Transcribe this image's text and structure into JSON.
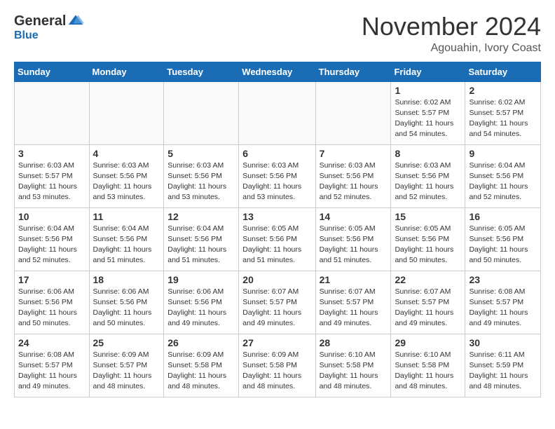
{
  "header": {
    "logo_general": "General",
    "logo_blue": "Blue",
    "month_title": "November 2024",
    "location": "Agouahin, Ivory Coast"
  },
  "weekdays": [
    "Sunday",
    "Monday",
    "Tuesday",
    "Wednesday",
    "Thursday",
    "Friday",
    "Saturday"
  ],
  "weeks": [
    [
      {
        "day": "",
        "info": ""
      },
      {
        "day": "",
        "info": ""
      },
      {
        "day": "",
        "info": ""
      },
      {
        "day": "",
        "info": ""
      },
      {
        "day": "",
        "info": ""
      },
      {
        "day": "1",
        "info": "Sunrise: 6:02 AM\nSunset: 5:57 PM\nDaylight: 11 hours\nand 54 minutes."
      },
      {
        "day": "2",
        "info": "Sunrise: 6:02 AM\nSunset: 5:57 PM\nDaylight: 11 hours\nand 54 minutes."
      }
    ],
    [
      {
        "day": "3",
        "info": "Sunrise: 6:03 AM\nSunset: 5:57 PM\nDaylight: 11 hours\nand 53 minutes."
      },
      {
        "day": "4",
        "info": "Sunrise: 6:03 AM\nSunset: 5:56 PM\nDaylight: 11 hours\nand 53 minutes."
      },
      {
        "day": "5",
        "info": "Sunrise: 6:03 AM\nSunset: 5:56 PM\nDaylight: 11 hours\nand 53 minutes."
      },
      {
        "day": "6",
        "info": "Sunrise: 6:03 AM\nSunset: 5:56 PM\nDaylight: 11 hours\nand 53 minutes."
      },
      {
        "day": "7",
        "info": "Sunrise: 6:03 AM\nSunset: 5:56 PM\nDaylight: 11 hours\nand 52 minutes."
      },
      {
        "day": "8",
        "info": "Sunrise: 6:03 AM\nSunset: 5:56 PM\nDaylight: 11 hours\nand 52 minutes."
      },
      {
        "day": "9",
        "info": "Sunrise: 6:04 AM\nSunset: 5:56 PM\nDaylight: 11 hours\nand 52 minutes."
      }
    ],
    [
      {
        "day": "10",
        "info": "Sunrise: 6:04 AM\nSunset: 5:56 PM\nDaylight: 11 hours\nand 52 minutes."
      },
      {
        "day": "11",
        "info": "Sunrise: 6:04 AM\nSunset: 5:56 PM\nDaylight: 11 hours\nand 51 minutes."
      },
      {
        "day": "12",
        "info": "Sunrise: 6:04 AM\nSunset: 5:56 PM\nDaylight: 11 hours\nand 51 minutes."
      },
      {
        "day": "13",
        "info": "Sunrise: 6:05 AM\nSunset: 5:56 PM\nDaylight: 11 hours\nand 51 minutes."
      },
      {
        "day": "14",
        "info": "Sunrise: 6:05 AM\nSunset: 5:56 PM\nDaylight: 11 hours\nand 51 minutes."
      },
      {
        "day": "15",
        "info": "Sunrise: 6:05 AM\nSunset: 5:56 PM\nDaylight: 11 hours\nand 50 minutes."
      },
      {
        "day": "16",
        "info": "Sunrise: 6:05 AM\nSunset: 5:56 PM\nDaylight: 11 hours\nand 50 minutes."
      }
    ],
    [
      {
        "day": "17",
        "info": "Sunrise: 6:06 AM\nSunset: 5:56 PM\nDaylight: 11 hours\nand 50 minutes."
      },
      {
        "day": "18",
        "info": "Sunrise: 6:06 AM\nSunset: 5:56 PM\nDaylight: 11 hours\nand 50 minutes."
      },
      {
        "day": "19",
        "info": "Sunrise: 6:06 AM\nSunset: 5:56 PM\nDaylight: 11 hours\nand 49 minutes."
      },
      {
        "day": "20",
        "info": "Sunrise: 6:07 AM\nSunset: 5:57 PM\nDaylight: 11 hours\nand 49 minutes."
      },
      {
        "day": "21",
        "info": "Sunrise: 6:07 AM\nSunset: 5:57 PM\nDaylight: 11 hours\nand 49 minutes."
      },
      {
        "day": "22",
        "info": "Sunrise: 6:07 AM\nSunset: 5:57 PM\nDaylight: 11 hours\nand 49 minutes."
      },
      {
        "day": "23",
        "info": "Sunrise: 6:08 AM\nSunset: 5:57 PM\nDaylight: 11 hours\nand 49 minutes."
      }
    ],
    [
      {
        "day": "24",
        "info": "Sunrise: 6:08 AM\nSunset: 5:57 PM\nDaylight: 11 hours\nand 49 minutes."
      },
      {
        "day": "25",
        "info": "Sunrise: 6:09 AM\nSunset: 5:57 PM\nDaylight: 11 hours\nand 48 minutes."
      },
      {
        "day": "26",
        "info": "Sunrise: 6:09 AM\nSunset: 5:58 PM\nDaylight: 11 hours\nand 48 minutes."
      },
      {
        "day": "27",
        "info": "Sunrise: 6:09 AM\nSunset: 5:58 PM\nDaylight: 11 hours\nand 48 minutes."
      },
      {
        "day": "28",
        "info": "Sunrise: 6:10 AM\nSunset: 5:58 PM\nDaylight: 11 hours\nand 48 minutes."
      },
      {
        "day": "29",
        "info": "Sunrise: 6:10 AM\nSunset: 5:58 PM\nDaylight: 11 hours\nand 48 minutes."
      },
      {
        "day": "30",
        "info": "Sunrise: 6:11 AM\nSunset: 5:59 PM\nDaylight: 11 hours\nand 48 minutes."
      }
    ]
  ]
}
